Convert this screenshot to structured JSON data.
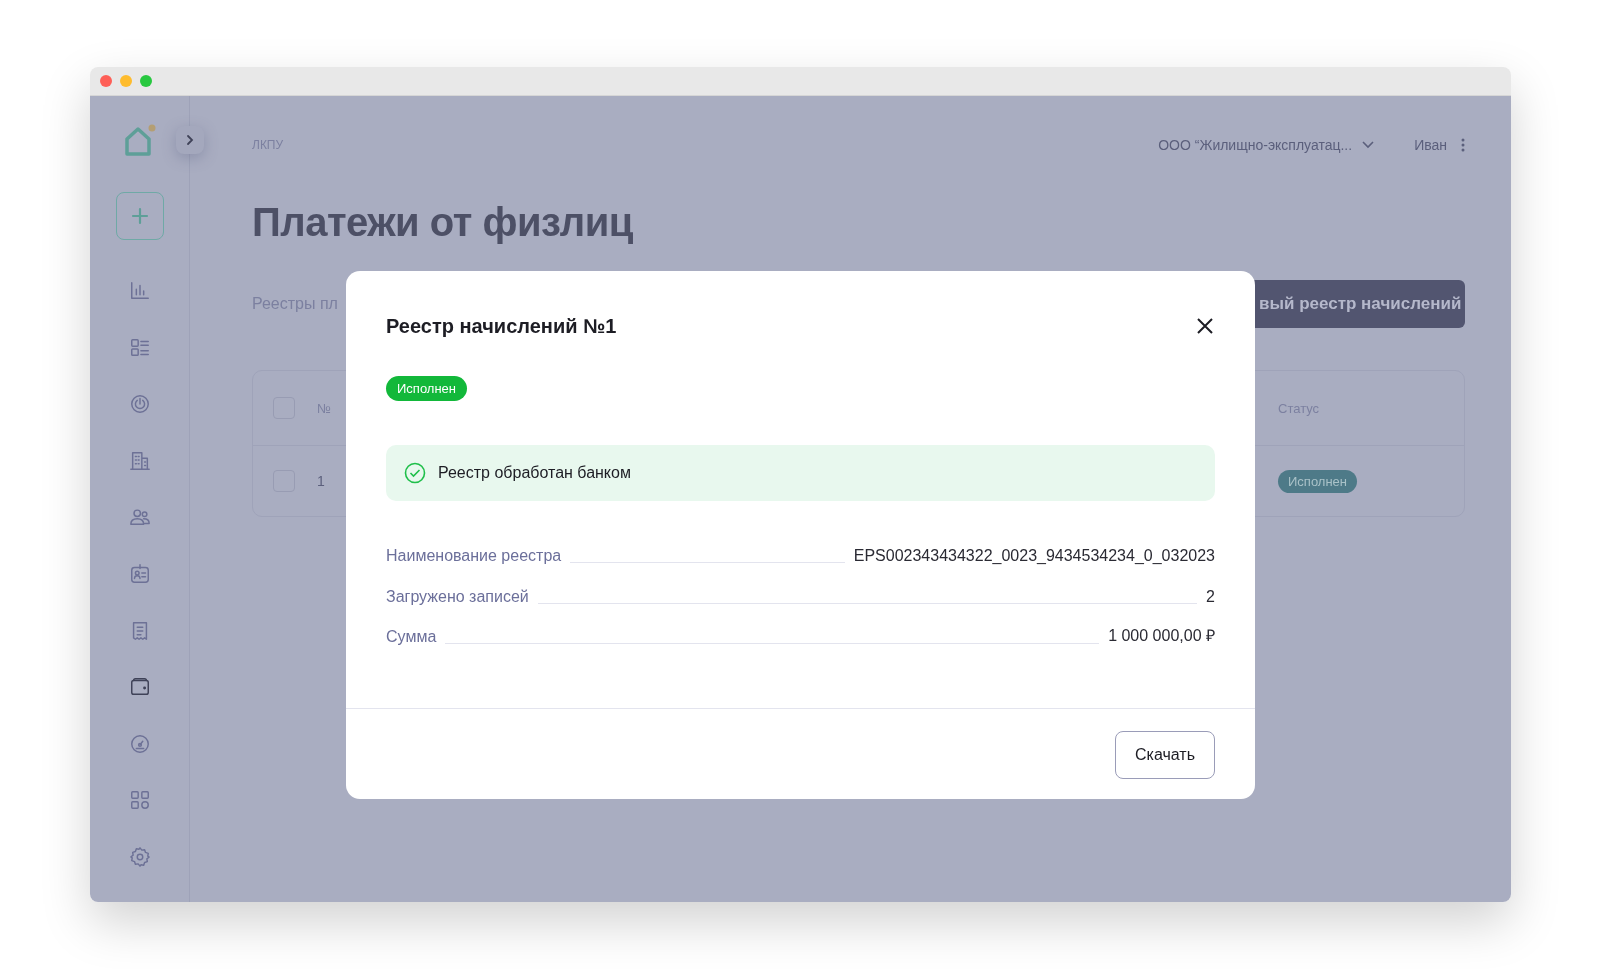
{
  "sidebar": {
    "items": [
      {
        "kind": "chart",
        "selected": false
      },
      {
        "kind": "list",
        "selected": false
      },
      {
        "kind": "power",
        "selected": false
      },
      {
        "kind": "building",
        "selected": false
      },
      {
        "kind": "users",
        "selected": false
      },
      {
        "kind": "badge",
        "selected": false
      },
      {
        "kind": "receipt",
        "selected": false
      },
      {
        "kind": "wallet",
        "selected": true
      },
      {
        "kind": "gauge",
        "selected": false
      },
      {
        "kind": "grid",
        "selected": false
      },
      {
        "kind": "gear",
        "selected": false
      }
    ]
  },
  "header": {
    "breadcrumb": "ЛКПУ",
    "organization": "ООО “Жилищно-эксплуатац...",
    "user": "Иван"
  },
  "page": {
    "title": "Платежи от физлиц",
    "section_label": "Реестры пл",
    "primary_button": "вый реестр начислений"
  },
  "table": {
    "header_checked": false,
    "columns": [
      "№",
      "Статус"
    ],
    "rows": [
      {
        "number": "1",
        "status": "Исполнен",
        "checked": false
      }
    ]
  },
  "modal": {
    "title": "Реестр начислений №1",
    "status": "Исполнен",
    "alert": "Реестр обработан банком",
    "fields": [
      {
        "label": "Наименование реестра",
        "value": "EPS002343434322_0023_9434534234_0_032023"
      },
      {
        "label": "Загружено записей",
        "value": "2"
      },
      {
        "label": "Сумма",
        "value": "1 000 000,00 ₽"
      }
    ],
    "download_button": "Скачать"
  }
}
